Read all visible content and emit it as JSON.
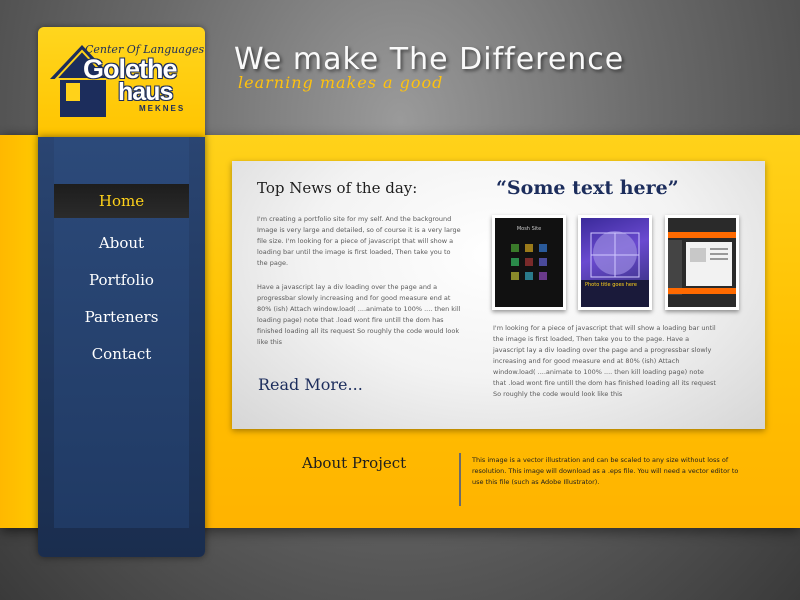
{
  "logo": {
    "center_label": "Center Of Languages",
    "brand_line1": "Golethe",
    "brand_line2": "haus",
    "city": "MEKNES"
  },
  "header": {
    "headline": "We make The Difference",
    "tagline": "learning makes a good"
  },
  "nav": {
    "items": [
      {
        "label": "Home",
        "active": true
      },
      {
        "label": "About"
      },
      {
        "label": "Portfolio"
      },
      {
        "label": "Parteners"
      },
      {
        "label": "Contact"
      }
    ]
  },
  "news": {
    "title": "Top News of the day:",
    "paragraph1": "I'm creating a portfolio site for my self. And the background Image is very large and detailed, so of course it is a very large file size. I'm looking for a piece of javascript that will show a loading bar until the image is first loaded, Then take you to the page.",
    "paragraph2": "Have a javascript lay a div loading over the page and a progressbar slowly increasing and for good measure end at 80% (ish) Attach window.load( ....animate to 100% .... then kill loading page) note that .load wont fire untill the dom has finished loading all its request So roughly the code would look like this",
    "read_more": "Read More..."
  },
  "featured": {
    "quote": "“Some text here”",
    "thumb1_title": "Mosh Site",
    "thumb2_caption": "Photo title goes here",
    "paragraph": "I'm looking for a piece of javascript that will show a loading bar until the image is first loaded, Then take you to the page. Have a javascript lay a div loading over the page and a progressbar slowly increasing and for good measure end at 80% (ish) Attach window.load( ....animate to 100% .... then kill loading page) note that .load wont fire untill the dom has finished loading all its request So roughly the code would look like this"
  },
  "about": {
    "title": "About Project",
    "text": "This image is a vector illustration and can be scaled to any size without loss of resolution. This image will download as a .eps file. You will need a vector editor to use this file (such as Adobe Illustrator)."
  },
  "colors": {
    "accent_yellow": "#ffc000",
    "nav_blue": "#203a64",
    "title_navy": "#1c2d5c"
  }
}
